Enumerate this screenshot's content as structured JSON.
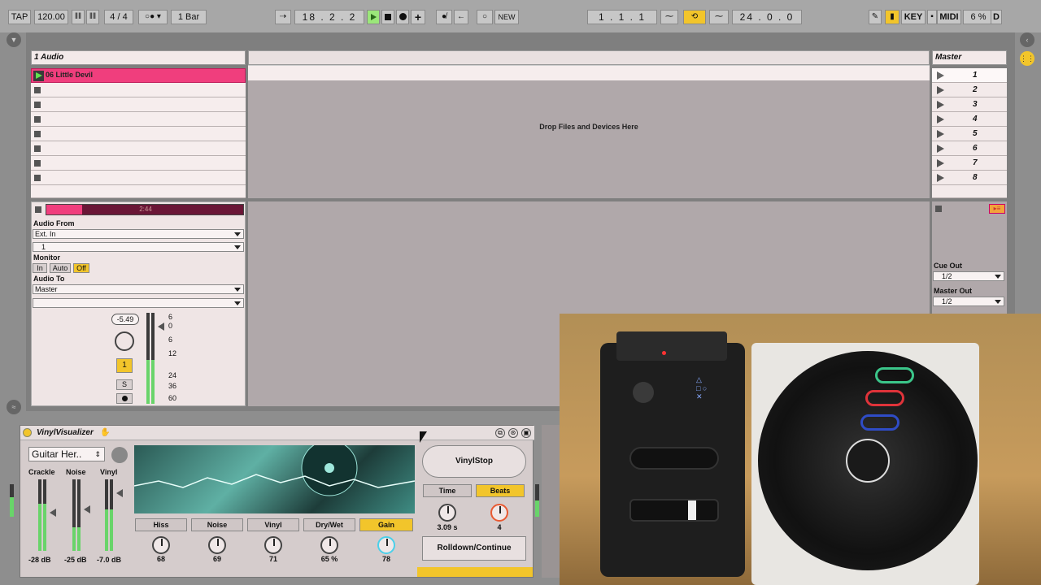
{
  "topbar": {
    "tap_label": "TAP",
    "tempo": "120.00",
    "signature_num": "4",
    "signature_den": "4",
    "quantize": "1 Bar",
    "position": "18 . 2 . 2",
    "new_label": "NEW",
    "loop_start": "1 . 1 . 1",
    "loop_length": "24 . 0 . 0",
    "key_label": "KEY",
    "midi_label": "MIDI",
    "cpu": "6 %",
    "d_label": "D"
  },
  "track": {
    "name": "1 Audio",
    "clips": [
      "06 Little Devil",
      "",
      "",
      "",
      "",
      "",
      "",
      ""
    ],
    "clip_position": "2:44",
    "drop_text": "Drop Files and Devices Here",
    "audio_from_label": "Audio From",
    "audio_from_value": "Ext. In",
    "input_channel": "1",
    "monitor_label": "Monitor",
    "monitor_in": "In",
    "monitor_auto": "Auto",
    "monitor_off": "Off",
    "audio_to_label": "Audio To",
    "audio_to_value": "Master",
    "volume": "-5.49",
    "track_number": "1",
    "solo_label": "S",
    "meter_scale": [
      "6",
      "0",
      "6",
      "12",
      "24",
      "36",
      "60"
    ]
  },
  "master": {
    "name": "Master",
    "scenes": [
      "1",
      "2",
      "3",
      "4",
      "5",
      "6",
      "7",
      "8"
    ],
    "cue_out_label": "Cue Out",
    "cue_out_value": "1/2",
    "master_out_label": "Master Out",
    "master_out_value": "1/2"
  },
  "device": {
    "name": "VinylVisualizer",
    "preset": "Guitar Her..",
    "crackle_label": "Crackle",
    "noise_label": "Noise",
    "vinyl_label": "Vinyl",
    "crackle_db": "-28 dB",
    "noise_db": "-25 dB",
    "vinyl_db": "-7.0 dB",
    "tabs": [
      "Hiss",
      "Noise",
      "Vinyl",
      "Dry/Wet",
      "Gain"
    ],
    "knob_values": [
      "68",
      "69",
      "71",
      "65 %",
      "78"
    ],
    "vinylstop_label": "VinylStop",
    "time_label": "Time",
    "beats_label": "Beats",
    "time_value": "3.09 s",
    "beats_value": "4",
    "rolldown_label": "Rolldown/Continue"
  }
}
